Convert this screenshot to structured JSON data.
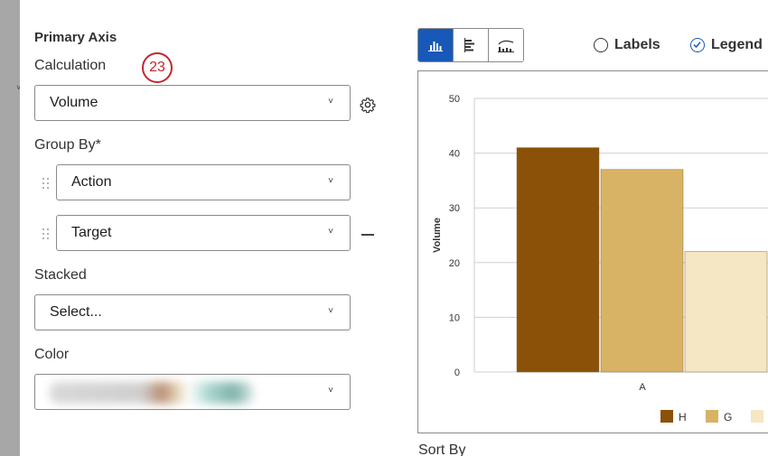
{
  "settings": {
    "section_title": "Primary Axis",
    "calculation_label": "Calculation",
    "callout_number": "23",
    "calculation_value": "Volume",
    "group_by_label": "Group By*",
    "group_by_items": [
      "Action",
      "Target"
    ],
    "stacked_label": "Stacked",
    "stacked_value": "Select...",
    "color_label": "Color"
  },
  "toolbar": {
    "buttons": [
      "column-chart-icon",
      "bar-chart-icon",
      "line-chart-icon"
    ],
    "active_index": 0,
    "labels_option": "Labels",
    "legend_option": "Legend",
    "accent_color": "#1858b8"
  },
  "sort_by_label": "Sort By",
  "chart_data": {
    "type": "bar",
    "categories": [
      "A"
    ],
    "series": [
      {
        "name": "H",
        "values": [
          41
        ],
        "color": "#8b5108"
      },
      {
        "name": "G",
        "values": [
          37
        ],
        "color": "#d8b366"
      },
      {
        "name": "",
        "values": [
          22
        ],
        "color": "#f5e6c4"
      }
    ],
    "ylabel": "Volume",
    "ylim": [
      0,
      50
    ],
    "yticks": [
      0,
      10,
      20,
      30,
      40,
      50
    ],
    "grid": true,
    "legend_position": "bottom"
  }
}
